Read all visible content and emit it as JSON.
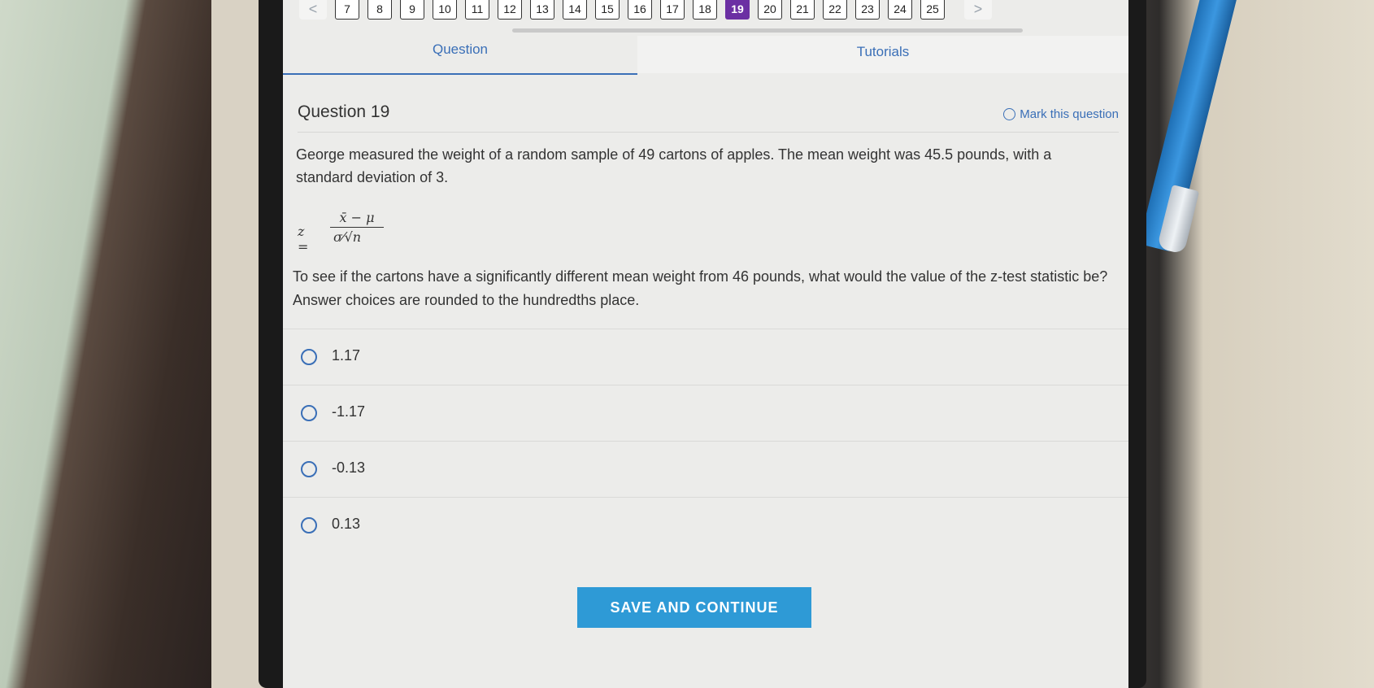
{
  "pager": {
    "prev_label": "<",
    "next_label": ">",
    "pages": [
      "7",
      "8",
      "9",
      "10",
      "11",
      "12",
      "13",
      "14",
      "15",
      "16",
      "17",
      "18",
      "19",
      "20",
      "21",
      "22",
      "23",
      "24",
      "25"
    ],
    "active": "19"
  },
  "tabs": {
    "question": "Question",
    "tutorials": "Tutorials"
  },
  "question": {
    "title": "Question 19",
    "mark_label": "Mark this question",
    "stem": "George measured the weight of a random sample of 49 cartons of apples. The mean weight was 45.5 pounds, with a standard deviation of 3.",
    "formula": {
      "lhs": "z =",
      "numerator": "x̄ − μ",
      "denominator": "σ⁄√n"
    },
    "prompt": "To see if the cartons have a significantly different mean weight from 46 pounds, what would the value of the z-test statistic be? Answer choices are rounded to the hundredths place."
  },
  "choices": [
    "1.17",
    "-1.17",
    "-0.13",
    "0.13"
  ],
  "save_button": "SAVE AND CONTINUE",
  "colors": {
    "accent": "#3a6fb7",
    "active_page": "#6b2fa3",
    "save_button": "#2e9ad6"
  }
}
